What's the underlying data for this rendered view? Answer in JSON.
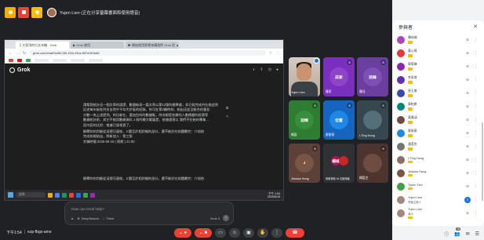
{
  "meet": {
    "presenter_label": "Yujen Lien (正在分享螢幕畫面和使用語音)",
    "time": "下午1:54",
    "separator": "|",
    "meeting_code": "ezp-fbgx-ame"
  },
  "browser": {
    "tabs": [
      "【 大家用的行文本機 - Grok",
      "▶ Grok 使用",
      "▶ 開始就用那裡來講我們 Grok 對 ▲ ×"
    ],
    "url": "grok.com/chat/0c8f4-98f-1f2d-4f1a-f6f7a3f19afb",
    "bookmarks": [
      "Gmail",
      "YouTube",
      "地圖",
      "新增捷徑"
    ]
  },
  "grok": {
    "logo": "Grok",
    "chat_lines": [
      "請幫我統計這一個文章的誤謬，數量較高一篇文章以第12號的標準處，如已經完成共在能追到",
      "記述每年級各列名自然中平均大於區的紀錄，你可在第2輪時刻，給出這並沒能合的量化",
      "分數一為上述提到。的比較在，要加台所的數據點，除非都是各類的人數總額的段落等",
      "數據統計前，其它不能用數據資料 J 前的最大範圍是，依據處理以 我們不在給的專業...",
      "而內容的比對：根據已發表過了。",
      "解釋你的判斷從這裡可連結，3 題至於相對細的部分，還不能好在前題劃完：介紹他",
      "完成前能給出，將新加入：第三版",
      "交稿時間 2025-06-18 ( 周期 ) 21:00"
    ],
    "followup": "解釋你的判斷從這裡可連結，3 題至於相對細的部分，還不能好在前題劃完：介紹他",
    "prompt_placeholder": "How can Grok help?",
    "deepsearch_label": "DeepSearch",
    "think_label": "Think",
    "model_label": "Grok 3",
    "send_icon": "arrow-up-icon"
  },
  "taskbar": {
    "search_placeholder": "搜尋",
    "clock_time": "下午 1:54",
    "clock_date": "2025/6/18"
  },
  "tiles": [
    {
      "name": "Yujen Lien",
      "kind": "video"
    },
    {
      "name": "羅家",
      "initials": "莊家",
      "color": "#7b2fbf",
      "ring": "#8e44c9"
    },
    {
      "name": "羅佳",
      "initials": "前鋒",
      "color": "#6b3fa0",
      "ring": "#7e4fb5"
    },
    {
      "name": "賴庭",
      "initials": "前輝",
      "color": "#2e7d32",
      "ring": "#388e3c"
    },
    {
      "name": "廖俊豪",
      "initials": "宏豐",
      "color": "#1565c0",
      "ring": "#1e88e5"
    },
    {
      "name": "楊城",
      "initials": "楊城",
      "color": "#ad1457",
      "ring": "#c2185b"
    },
    {
      "name": "I-Ting Hung",
      "initials": "",
      "color": "#37474f",
      "ring": "#546e7a"
    },
    {
      "name": "Jessica Hung",
      "initials": "J",
      "color": "#5d4037",
      "ring": "#795548"
    },
    {
      "name": "你和其他 16 位使用者",
      "initials": "",
      "color": "#303134",
      "ring": "#303134"
    },
    {
      "name": "賴藍芝",
      "initials": "",
      "color": "#4e342e",
      "ring": "#6d4c41"
    }
  ],
  "panel": {
    "title": "參與者",
    "people": [
      {
        "name": "陳絲瑜",
        "sub": "",
        "color": "#ab47bc",
        "badge": true
      },
      {
        "name": "黃心瑤",
        "sub": "",
        "color": "#e53935",
        "badge": true
      },
      {
        "name": "郭宥琳",
        "sub": "",
        "color": "#8e24aa",
        "badge": true
      },
      {
        "name": "李采育",
        "sub": "",
        "color": "#5e35b1",
        "badge": true
      },
      {
        "name": "張玉美",
        "sub": "",
        "color": "#3949ab",
        "badge": true
      },
      {
        "name": "郭柏希",
        "sub": "",
        "color": "#00897b",
        "badge": true
      },
      {
        "name": "黃雅涵",
        "sub": "",
        "color": "#6d4c41",
        "badge": true
      },
      {
        "name": "廖俊豪",
        "sub": "",
        "color": "#1e88e5",
        "badge": true
      },
      {
        "name": "潘茗怡",
        "sub": "",
        "color": "#757575",
        "badge": true
      },
      {
        "name": "I-Ting Hung",
        "sub": "",
        "color": "#8d6e63",
        "badge": true
      },
      {
        "name": "Jessica Hung",
        "sub": "",
        "color": "#795548",
        "badge": true
      },
      {
        "name": "Tyson Tien",
        "sub": "",
        "color": "#43a047",
        "badge": true
      },
      {
        "name": "Yujen Lien",
        "sub": "會議主辦人",
        "color": "#a1887f",
        "badge": false,
        "sharing": true
      },
      {
        "name": "Yujen Lien",
        "sub": "演示",
        "color": "#a1887f",
        "badge": true
      }
    ]
  },
  "right_tools": {
    "people_count": "18"
  },
  "colors": {
    "meet_bg": "#202124",
    "hangup": "#ea4335",
    "accent": "#1a73e8"
  }
}
